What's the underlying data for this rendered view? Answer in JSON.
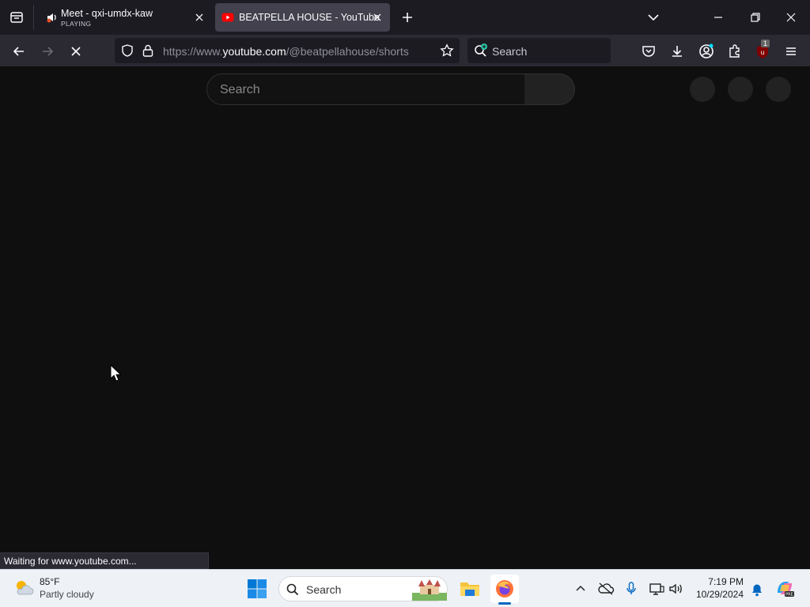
{
  "browser": {
    "tabs": [
      {
        "title": "Meet - qxi-umdx-kaw",
        "subtitle": "PLAYING",
        "active": false
      },
      {
        "title": "BEATPELLA HOUSE - YouTube",
        "active": true
      }
    ],
    "url": {
      "prefix": "https://www.",
      "host": "youtube.com",
      "path": "/@beatpellahouse/shorts"
    },
    "search_placeholder": "Search",
    "extension_badge": "1",
    "status_text": "Waiting for www.youtube.com..."
  },
  "page": {
    "search_placeholder": "Search"
  },
  "taskbar": {
    "weather": {
      "temp": "85°F",
      "condition": "Partly cloudy"
    },
    "search_placeholder": "Search",
    "clock": {
      "time": "7:19 PM",
      "date": "10/29/2024"
    },
    "pinned_apps": [
      "file-explorer",
      "firefox"
    ]
  },
  "colors": {
    "tab_strip": "#1c1b22",
    "toolbar": "#2b2a33",
    "page_bg": "#0f0f0f",
    "youtube_red": "#ff0000",
    "taskbar_bg": "#eef1f6",
    "accent": "#0067c0"
  }
}
